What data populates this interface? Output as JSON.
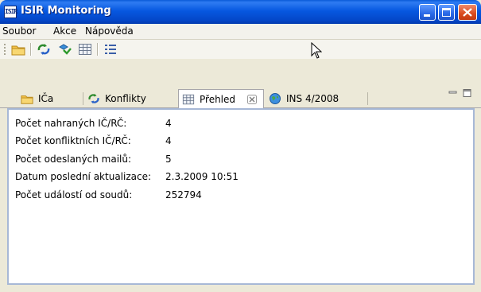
{
  "window": {
    "title": "ISIR Monitoring",
    "app_icon_text": "ISIR",
    "colors": {
      "titlebar": "#0758e0",
      "content_border": "#a7b8d6",
      "chrome": "#ece9d8"
    }
  },
  "menu": {
    "items": [
      {
        "label": "Soubor"
      },
      {
        "label": "Akce"
      },
      {
        "label": "Nápověda"
      }
    ]
  },
  "toolbar": {
    "tools": [
      {
        "icon": "folder-icon"
      },
      {
        "icon": "conflicts-icon"
      },
      {
        "icon": "sync-icon"
      },
      {
        "icon": "table-icon"
      },
      {
        "icon": "list-icon"
      }
    ]
  },
  "tabs": [
    {
      "label": "IČa",
      "icon": "folder-icon",
      "active": false
    },
    {
      "label": "Konflikty",
      "icon": "conflicts-icon",
      "active": false
    },
    {
      "label": "Přehled",
      "icon": "table-icon",
      "active": true
    },
    {
      "label": "INS 4/2008",
      "icon": "globe-icon",
      "active": false
    }
  ],
  "overview": {
    "rows": [
      {
        "label": "Počet nahraných IČ/RČ:",
        "value": "4"
      },
      {
        "label": "Počet konfliktních IČ/RČ:",
        "value": "4"
      },
      {
        "label": "Počet odeslaných mailů:",
        "value": "5"
      },
      {
        "label": "Datum poslední aktualizace:",
        "value": "2.3.2009 10:51"
      },
      {
        "label": "Počet událostí od soudů:",
        "value": "252794"
      }
    ]
  }
}
